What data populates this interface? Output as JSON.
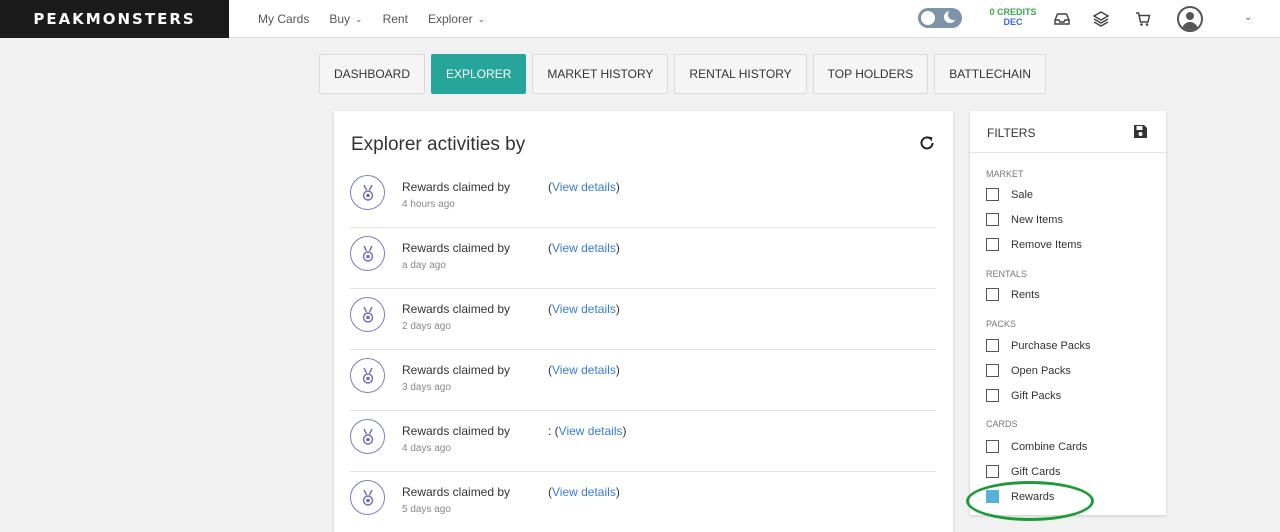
{
  "header": {
    "logo": "PEAKMONSTERS",
    "nav": [
      {
        "label": "My Cards",
        "dropdown": false
      },
      {
        "label": "Buy",
        "dropdown": true
      },
      {
        "label": "Rent",
        "dropdown": false
      },
      {
        "label": "Explorer",
        "dropdown": true
      }
    ],
    "credits_line1": "0 CREDITS",
    "credits_line2": "DEC",
    "icons": [
      "inbox-icon",
      "layers-icon",
      "cart-icon",
      "user-avatar-icon",
      "chevron-down-icon"
    ]
  },
  "tabs": [
    {
      "label": "DASHBOARD",
      "active": false
    },
    {
      "label": "EXPLORER",
      "active": true
    },
    {
      "label": "MARKET HISTORY",
      "active": false
    },
    {
      "label": "RENTAL HISTORY",
      "active": false
    },
    {
      "label": "TOP HOLDERS",
      "active": false
    },
    {
      "label": "BATTLECHAIN",
      "active": false
    }
  ],
  "main": {
    "title": "Explorer activities by",
    "link_text": "View details",
    "activities": [
      {
        "text": "Rewards claimed by",
        "prefix": "(",
        "suffix": ")",
        "time": "4 hours ago"
      },
      {
        "text": "Rewards claimed by",
        "prefix": "(",
        "suffix": ")",
        "time": "a day ago"
      },
      {
        "text": "Rewards claimed by",
        "prefix": "(",
        "suffix": ")",
        "time": "2 days ago"
      },
      {
        "text": "Rewards claimed by",
        "prefix": "(",
        "suffix": ")",
        "time": "3 days ago"
      },
      {
        "text": "Rewards claimed by",
        "prefix": ": (",
        "suffix": ")",
        "time": "4 days ago"
      },
      {
        "text": "Rewards claimed by",
        "prefix": "(",
        "suffix": ")",
        "time": "5 days ago"
      }
    ]
  },
  "filters": {
    "title": "FILTERS",
    "groups": [
      {
        "label": "MARKET",
        "items": [
          {
            "label": "Sale",
            "checked": false
          },
          {
            "label": "New Items",
            "checked": false
          },
          {
            "label": "Remove Items",
            "checked": false
          }
        ]
      },
      {
        "label": "RENTALS",
        "items": [
          {
            "label": "Rents",
            "checked": false
          }
        ]
      },
      {
        "label": "PACKS",
        "items": [
          {
            "label": "Purchase Packs",
            "checked": false
          },
          {
            "label": "Open Packs",
            "checked": false
          },
          {
            "label": "Gift Packs",
            "checked": false
          }
        ]
      },
      {
        "label": "CARDS",
        "items": [
          {
            "label": "Combine Cards",
            "checked": false
          },
          {
            "label": "Gift Cards",
            "checked": false
          },
          {
            "label": "Rewards",
            "checked": true
          }
        ]
      }
    ]
  },
  "colors": {
    "accent": "#26a69a",
    "link": "#3a7bd5",
    "checked": "#5bb0d9",
    "highlight": "#1e9a3c"
  }
}
